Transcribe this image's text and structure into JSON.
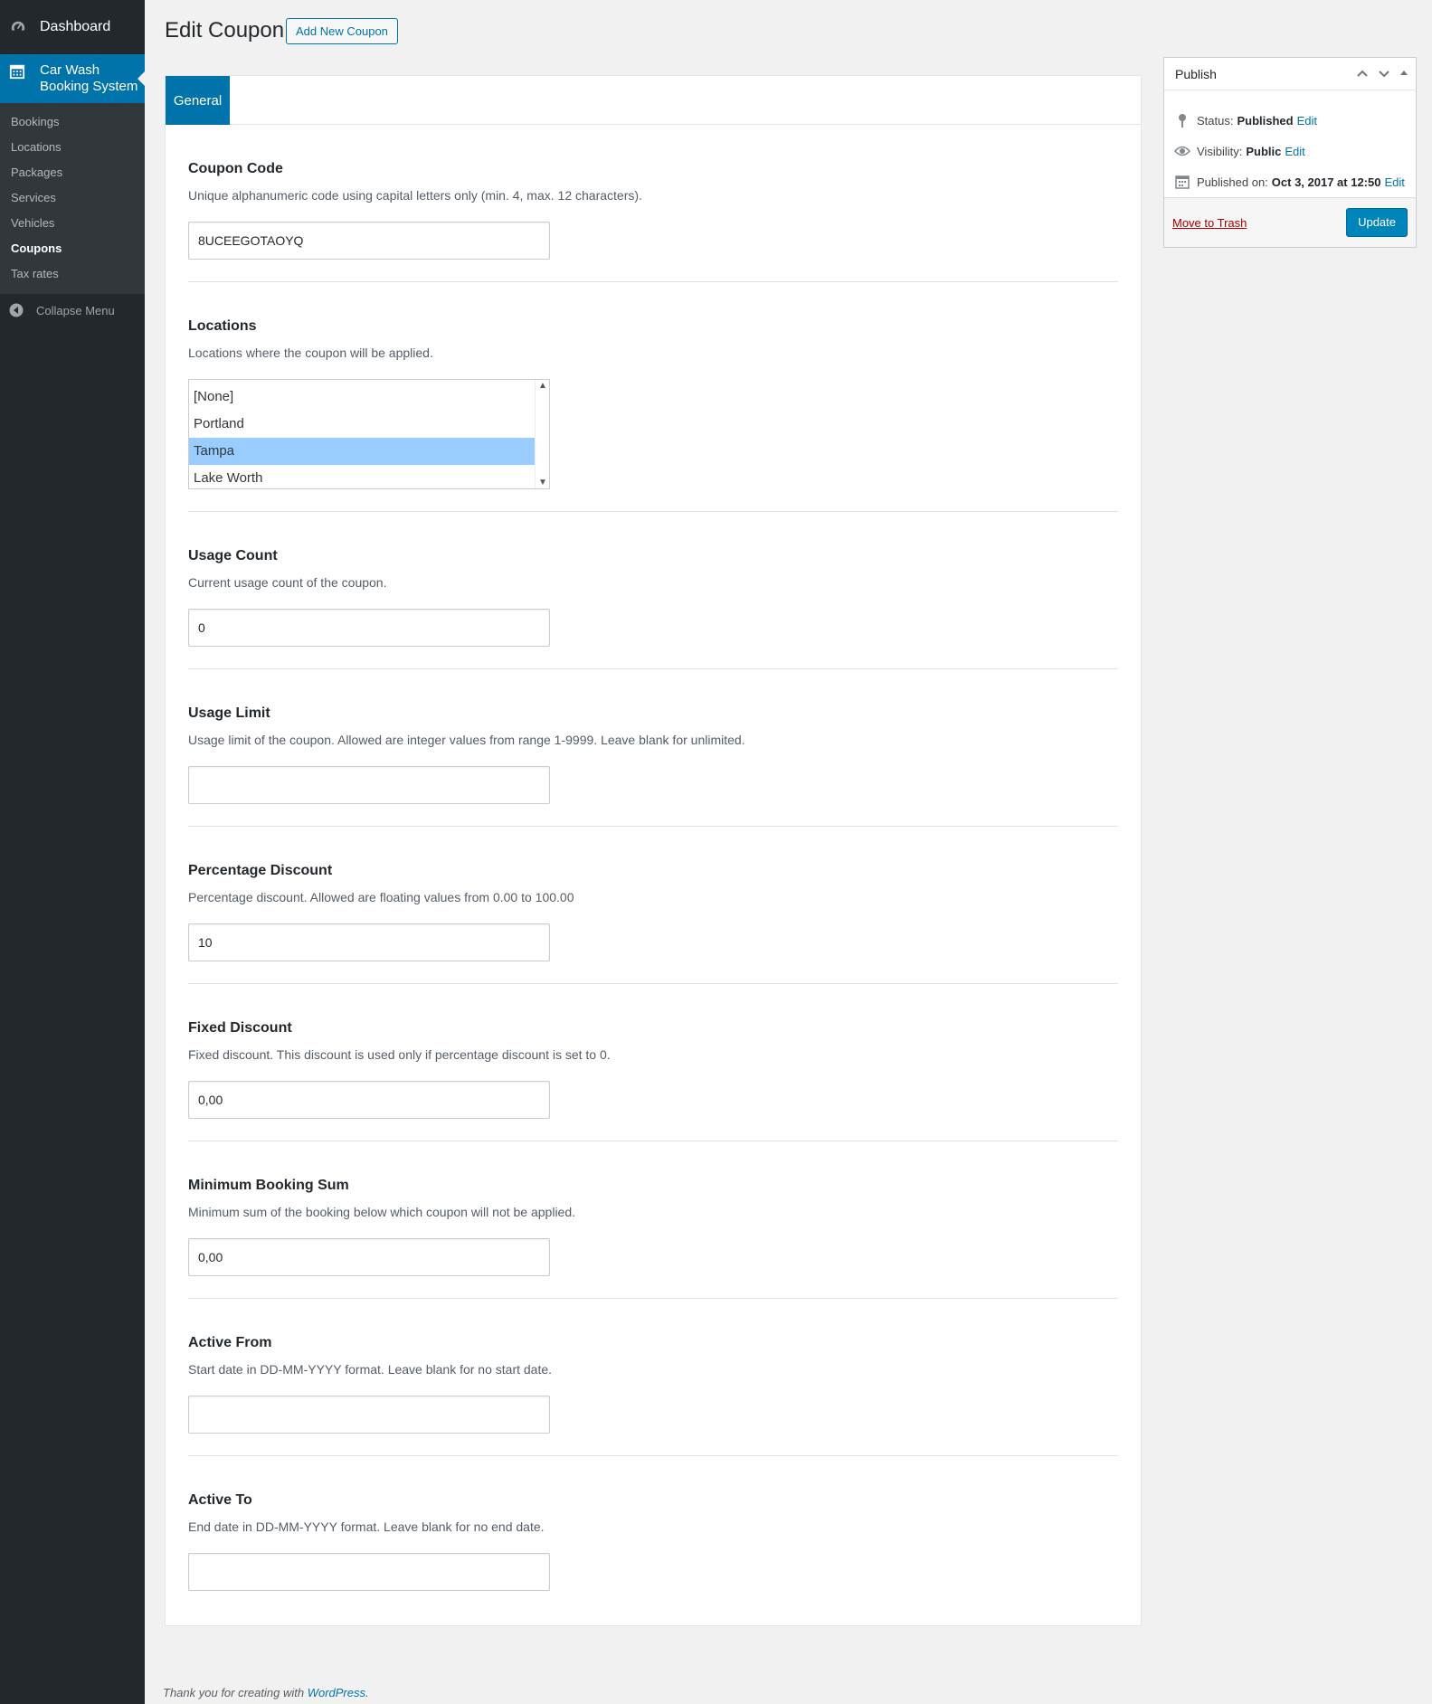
{
  "sidebar": {
    "dashboard_label": "Dashboard",
    "active_label_line1": "Car Wash",
    "active_label_line2": "Booking System",
    "items": [
      {
        "label": "Bookings"
      },
      {
        "label": "Locations"
      },
      {
        "label": "Packages"
      },
      {
        "label": "Services"
      },
      {
        "label": "Vehicles"
      },
      {
        "label": "Coupons"
      },
      {
        "label": "Tax rates"
      }
    ],
    "current_item": "Coupons",
    "collapse_label": "Collapse Menu"
  },
  "header": {
    "title": "Edit Coupon",
    "add_new_label": "Add New Coupon"
  },
  "tabs": [
    {
      "label": "General"
    }
  ],
  "fields": {
    "coupon_code": {
      "label": "Coupon Code",
      "description": "Unique alphanumeric code using capital letters only (min. 4, max. 12 characters).",
      "value": "8UCEEGOTAOYQ"
    },
    "locations": {
      "label": "Locations",
      "description": "Locations where the coupon will be applied.",
      "options": [
        "[None]",
        "Portland",
        "Tampa",
        "Lake Worth"
      ],
      "selected": "Tampa"
    },
    "usage_count": {
      "label": "Usage Count",
      "description": "Current usage count of the coupon.",
      "value": "0"
    },
    "usage_limit": {
      "label": "Usage Limit",
      "description": "Usage limit of the coupon. Allowed are integer values from range 1-9999. Leave blank for unlimited.",
      "value": ""
    },
    "percentage_discount": {
      "label": "Percentage Discount",
      "description": "Percentage discount. Allowed are floating values from 0.00 to 100.00",
      "value": "10"
    },
    "fixed_discount": {
      "label": "Fixed Discount",
      "description": "Fixed discount. This discount is used only if percentage discount is set to 0.",
      "value": "0,00"
    },
    "minimum_booking_sum": {
      "label": "Minimum Booking Sum",
      "description": "Minimum sum of the booking below which coupon will not be applied.",
      "value": "0,00"
    },
    "active_from": {
      "label": "Active From",
      "description": "Start date in DD-MM-YYYY format. Leave blank for no start date.",
      "value": ""
    },
    "active_to": {
      "label": "Active To",
      "description": "End date in DD-MM-YYYY format. Leave blank for no end date.",
      "value": ""
    }
  },
  "publish": {
    "title": "Publish",
    "status_label": "Status:",
    "status_value": "Published",
    "visibility_label": "Visibility:",
    "visibility_value": "Public",
    "published_label": "Published on:",
    "published_value": "Oct 3, 2017 at 12:50",
    "edit_label": "Edit",
    "trash_label": "Move to Trash",
    "update_label": "Update"
  },
  "footer": {
    "text": "Thank you for creating with ",
    "link": "WordPress",
    "suffix": "."
  },
  "colors": {
    "sidebar_bg": "#23282d",
    "submenu_bg": "#32373c",
    "accent": "#0073aa",
    "selected_option": "#99ccff",
    "trash": "#aa0000"
  }
}
